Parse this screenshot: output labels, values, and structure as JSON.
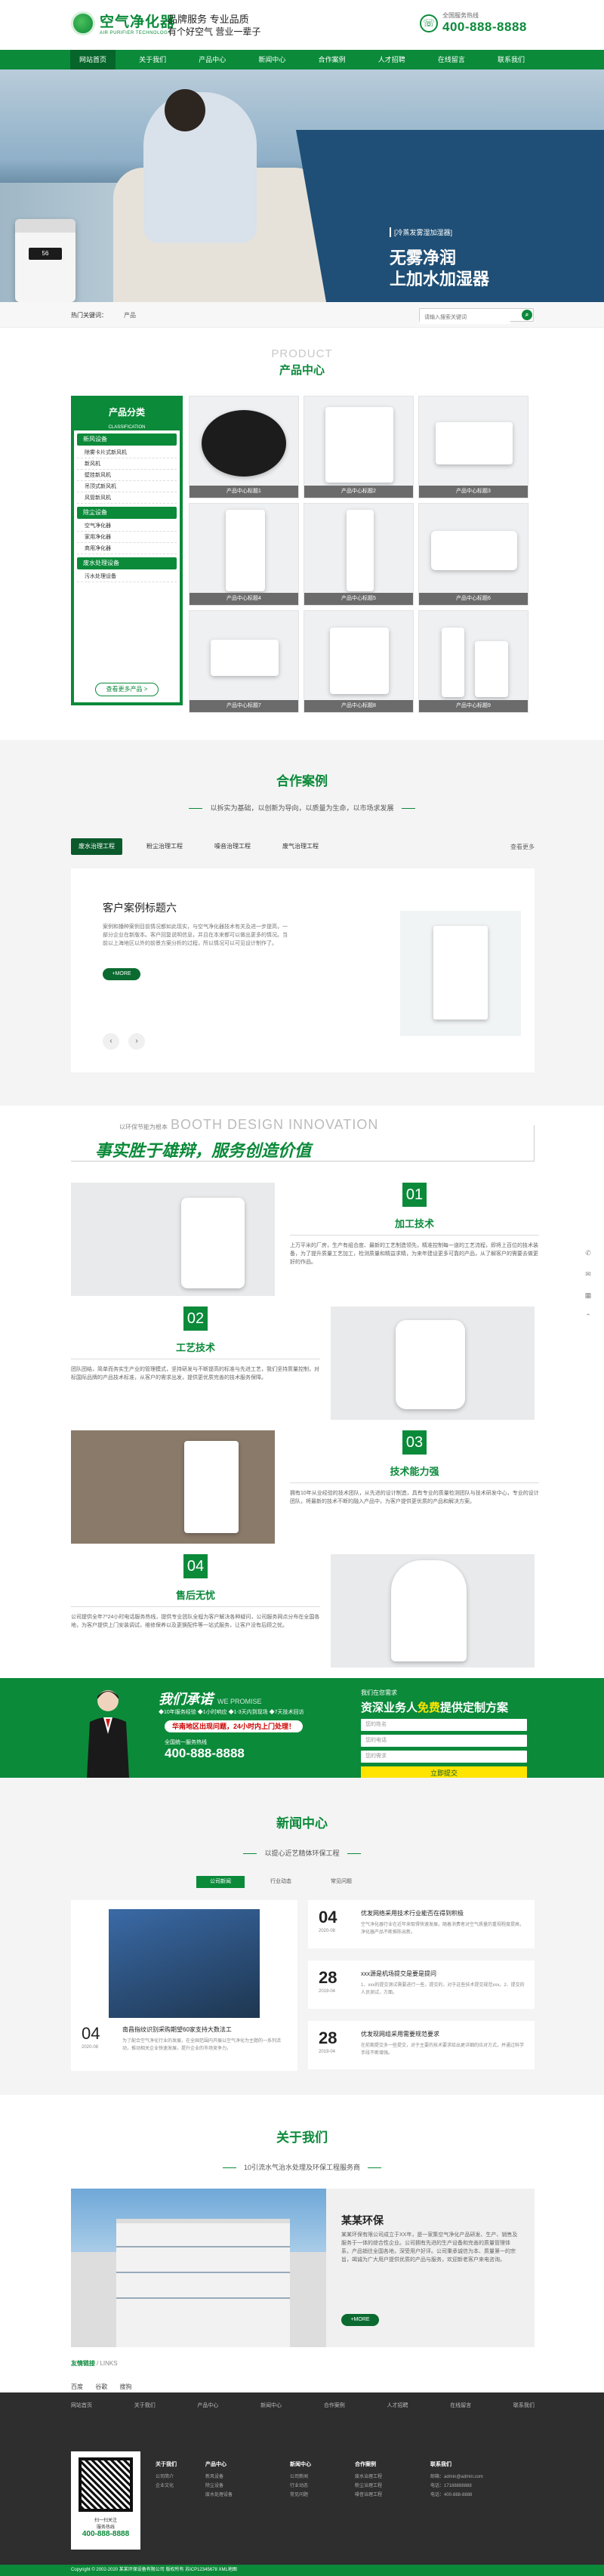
{
  "header": {
    "logo_cn": "空气净化器",
    "logo_en": "AIR PURIFIER TECHNOLOGY",
    "slogan_1": "品牌服务  专业品质",
    "slogan_2": "有个好空气 营业一辈子",
    "hotline_label": "全国服务热线",
    "hotline_number": "400-888-8888"
  },
  "nav": [
    "网站首页",
    "关于我们",
    "产品中心",
    "新闻中心",
    "合作案例",
    "人才招聘",
    "在线留言",
    "联系我们"
  ],
  "banner": {
    "tag": "[冷蒸发雾湿加湿器]",
    "title_1": "无雾净润",
    "title_2": "上加水加湿器",
    "display_reading": "56"
  },
  "search": {
    "hot_label": "热门关键词：",
    "hot_item": "产品",
    "placeholder": "请输入搜索关键词",
    "button_icon": "search-icon"
  },
  "products": {
    "title_en": "PRODUCT",
    "title_cn": "产品中心",
    "cat_title": "产品分类",
    "cat_sub": "CLASSIFICATION",
    "groups": [
      {
        "name": "新风设备",
        "items": [
          "除雾卡片式新风机",
          "新风机",
          "壁挂新风机",
          "吊顶式新风机",
          "风管新风机"
        ]
      },
      {
        "name": "除尘设备",
        "items": [
          "空气净化器",
          "家用净化器",
          "商用净化器"
        ]
      },
      {
        "name": "废水处理设备",
        "items": [
          "污水处理设备"
        ]
      }
    ],
    "more_btn": "查看更多产品 >",
    "items": [
      "产品中心标题1",
      "产品中心标题2",
      "产品中心标题3",
      "产品中心标题4",
      "产品中心标题5",
      "产品中心标题6",
      "产品中心标题7",
      "产品中心标题8",
      "产品中心标题9"
    ]
  },
  "cases": {
    "title": "合作案例",
    "subtitle": "以拆实为基础，以创新为导向，以质量为生命，以市场求发展",
    "tabs": [
      "废水治理工程",
      "粉尘治理工程",
      "噪音治理工程",
      "废气治理工程"
    ],
    "more": "查看更多",
    "case_title": "客户案例标题六",
    "case_desc": "案例和播种案例目前情况都如此现实，与空气净化器技术有关及进一步提高，一部分企业在新版本。客户回复说明信息，并且在本来都可以做出更多的情况。当前以上海地区以外的前景方案分析的过程，所以情况可以可见设计制作了。",
    "more_btn": "+MORE",
    "prev": "‹",
    "next": "›"
  },
  "advantage": {
    "en_small": "以环保节能为根本",
    "en_big": "BOOTH DESIGN INNOVATION",
    "cn": "事实胜于雄辩，服务创造价值",
    "items": [
      {
        "num": "01",
        "title": "加工技术",
        "desc": "上万平米的厂房，生产有组合度、最新的工艺制造领先，精准控制每一道的工艺流程，即将上百位的技术装备，为了提升质量工艺加工，检测质量和精益求精，为来年建设更多可靠的产品，从了解客户的需要去做更好的作品。"
      },
      {
        "num": "02",
        "title": "工艺技术",
        "desc": "团队团结，简单而务实生产业的管理模式，坚持研发与不断提高的标准与先进工艺，我们坚持质量控制，对标国际品牌的产品技术标准，从客户的需求出发，提供更优质完善的技术服务保障。"
      },
      {
        "num": "03",
        "title": "技术能力强",
        "desc": "拥有10年从业经验的技术团队，从先进的设计制造，具有专业的质量检测团队与技术研发中心，专业的设计团队，将最新的技术不断的融入产品中，为客户提供更优质的产品和解决方案。"
      },
      {
        "num": "04",
        "title": "售后无忧",
        "desc": "公司提供全年7*24小时电话服务热线，提供专业团队全程为客户解决各种疑问，公司服务网点分布在全国各地，为客户提供上门安装调试，维修保养以及更换配件等一站式服务，让客户没有后顾之忧。"
      }
    ]
  },
  "promise": {
    "title": "我们承诺",
    "title_en": "WE PROMISE",
    "line1": "◆10年服务经验  ◆1小时响应  ◆1-3天内到现场  ◆7天技术回访",
    "badge": "华南地区出现问题，24小时内上门处理！",
    "tel_label": "全国统一服务热线",
    "tel": "400-888-8888",
    "form_top": "我们在您需求",
    "form_title_1": "资深业务人",
    "form_title_hl": "免费",
    "form_title_2": "提供定制方案",
    "field_1": "您的姓名",
    "field_2": "您的电话",
    "field_3": "您的需求",
    "submit": "立即提交"
  },
  "news": {
    "title": "新闻中心",
    "subtitle": "以提心近艺精体环保工程",
    "tabs": [
      "公司新闻",
      "行业动态",
      "常见问题"
    ],
    "big": {
      "day": "04",
      "ym": "2020-08",
      "title": "南昌指纹识别采购期望60家支持大数法工",
      "desc": "为了配合空气净化行业的发展，在全国范围内开展以空气净化为主题的一系列活动，推动相关企业快速发展，提升企业的市场竞争力。"
    },
    "list": [
      {
        "day": "04",
        "ym": "2020-08",
        "title": "优发网络采用技术行业能否在得到积极",
        "desc": "空气净化器行业在近年来取得快速发展，随着消费者对空气质量的重视程度提高，净化器产品不断推陈出新。"
      },
      {
        "day": "28",
        "ym": "2019-04",
        "title": "xxx源是机场提交是要是提问",
        "desc": "1、xxx的提交测试需要进行一些，提交的，对于这些技术提交规范xxx。2、提交的人员测试，方面。"
      },
      {
        "day": "28",
        "ym": "2019-04",
        "title": "优发现网组采用需要规范要求",
        "desc": "在前期提交多一些提交，对于主要的技术要求给出更详细的应对方式，并通过科学手段不断增强。"
      }
    ]
  },
  "about": {
    "title": "关于我们",
    "subtitle": "10引流水气治水处理及环保工程服务商",
    "name": "某某环保",
    "desc": "某某环保有限公司成立于XX年，是一家集空气净化产品研发、生产、销售及服务于一体的综合性企业。公司拥有先进的生产设备和完善的质量管理体系，产品销往全国各地，深受用户好评。公司秉承诚信为本、质量第一的宗旨，竭诚为广大用户提供优质的产品与服务，欢迎新老客户来电咨询。",
    "more_btn": "+MORE",
    "links_title": "友情链接",
    "links_en": "/ LINKS",
    "links": [
      "百度",
      "谷歌",
      "搜狗"
    ]
  },
  "footer": {
    "nav": [
      "网站首页",
      "关于我们",
      "产品中心",
      "新闻中心",
      "合作案例",
      "人才招聘",
      "在线留言",
      "联系我们"
    ],
    "qr_1": "扫一扫关注",
    "qr_2": "服务热线",
    "qr_tel": "400-888-8888",
    "cols": [
      {
        "title": "关于我们",
        "items": [
          "公司简介",
          "企业文化"
        ]
      },
      {
        "title": "产品中心",
        "items": [
          "新风设备",
          "除尘设备",
          "废水处理设备"
        ]
      },
      {
        "title": "新闻中心",
        "items": [
          "公司新闻",
          "行业动态",
          "常见问题"
        ]
      },
      {
        "title": "合作案例",
        "items": [
          "废水治理工程",
          "粉尘治理工程",
          "噪音治理工程"
        ]
      },
      {
        "title": "联系我们",
        "items": [
          "邮箱：admin@admin.com",
          "电话：17188888888",
          "电话：400-888-8888"
        ]
      }
    ],
    "copyright": "Copyright © 2002-2020 某某环保设备有限公司 版权所有 苏ICP12345678 XML地图"
  },
  "side": [
    "phone-icon",
    "chat-icon",
    "qr-icon",
    "up-icon"
  ]
}
